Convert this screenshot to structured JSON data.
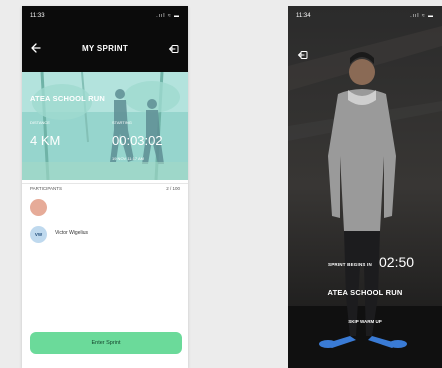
{
  "screen1": {
    "status": {
      "time": "11:33",
      "signal": ".ııl ≈ ▬"
    },
    "header": {
      "title": "MY SPRINT"
    },
    "race": {
      "name": "ATEA SCHOOL RUN",
      "distance_label": "DISTANCE",
      "starting_label": "STARTING",
      "distance": "4 KM",
      "countdown": "00:03:02",
      "date": "19 NOV 11:17 AM"
    },
    "participants": {
      "label": "PARTICIPANTS",
      "count": "2 / 100",
      "items": [
        {
          "initials": "",
          "name": ""
        },
        {
          "initials": "VW",
          "name": "Victor Wigelius"
        }
      ]
    },
    "enter_button": "Enter Sprint"
  },
  "screen2": {
    "status": {
      "time": "11:34",
      "signal": ".ııl ≈ ▬"
    },
    "sprint_begins_label": "SPRINT BEGINS IN",
    "countdown": "02:50",
    "race_name": "ATEA SCHOOL RUN",
    "skip_label": "SKIP WARM UP"
  },
  "colors": {
    "accent": "#6bda9a",
    "hero": "#8ed2c9",
    "avatar_peach": "#e6ab98",
    "avatar_blue": "#bfd9ee"
  },
  "icons": [
    "back-arrow-icon",
    "exit-icon",
    "signal-icon"
  ]
}
